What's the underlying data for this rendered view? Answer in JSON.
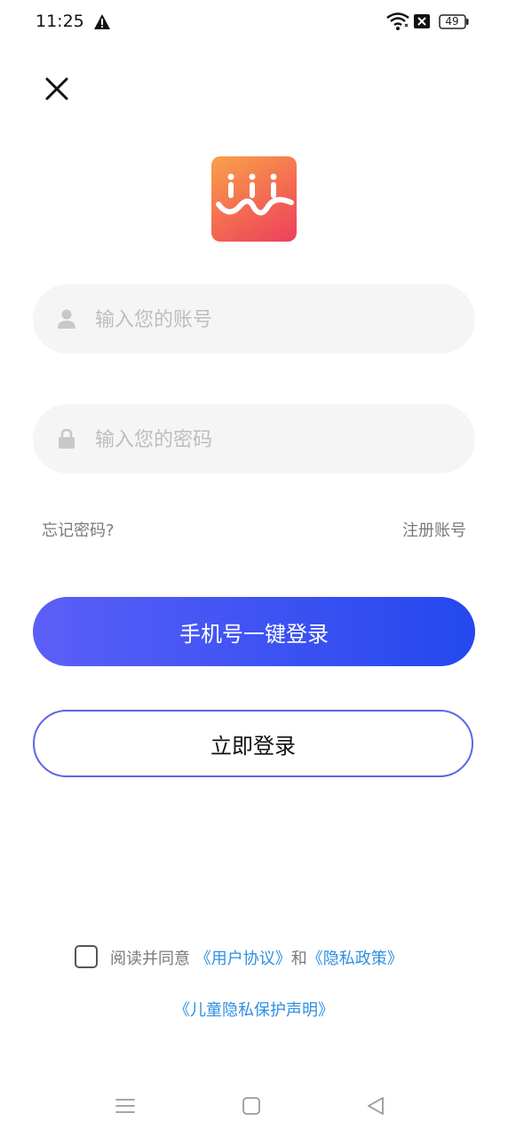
{
  "status_bar": {
    "time": "11:25",
    "battery": "49"
  },
  "login": {
    "account_placeholder": "输入您的账号",
    "password_placeholder": "输入您的密码",
    "forgot_label": "忘记密码?",
    "register_label": "注册账号",
    "onekey_label": "手机号一键登录",
    "login_label": "立即登录"
  },
  "agreement": {
    "prefix": "阅读并同意",
    "user_agreement": "《用户协议》",
    "and": "和",
    "privacy_policy": "《隐私政策》",
    "child_privacy": "《儿童隐私保护声明》"
  },
  "colors": {
    "primary_gradient_start": "#5b5ff7",
    "primary_gradient_end": "#2448ef",
    "link_blue": "#2f8fe0",
    "logo_orange": "#f8a24a",
    "logo_pink": "#ec3f5c"
  },
  "icons": [
    "alert-icon",
    "wifi-icon",
    "sim-icon",
    "battery-icon",
    "close-icon",
    "user-icon",
    "lock-icon",
    "menu-icon",
    "home-icon",
    "back-icon"
  ]
}
